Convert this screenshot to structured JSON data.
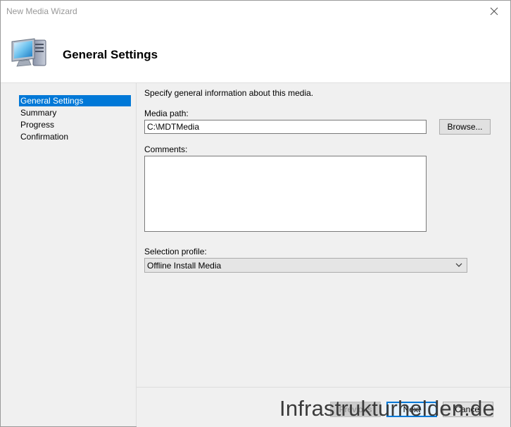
{
  "window": {
    "title": "New Media Wizard"
  },
  "header": {
    "title": "General Settings",
    "icon": "computer-icon"
  },
  "nav": {
    "items": [
      {
        "label": "General Settings",
        "active": true
      },
      {
        "label": "Summary"
      },
      {
        "label": "Progress"
      },
      {
        "label": "Confirmation"
      }
    ]
  },
  "form": {
    "intro": "Specify general information about this media.",
    "media_path_label": "Media path:",
    "media_path_value": "C:\\MDTMedia",
    "browse_label": "Browse...",
    "comments_label": "Comments:",
    "comments_value": "",
    "selection_profile_label": "Selection profile:",
    "selection_profile_value": "Offline Install Media"
  },
  "footer": {
    "previous_label": "Previous",
    "next_label": "Next",
    "cancel_label": "Cancel"
  },
  "watermark": "Infrastrukturhelden.de",
  "colors": {
    "accent": "#0078d7",
    "background": "#f0f0f0"
  }
}
